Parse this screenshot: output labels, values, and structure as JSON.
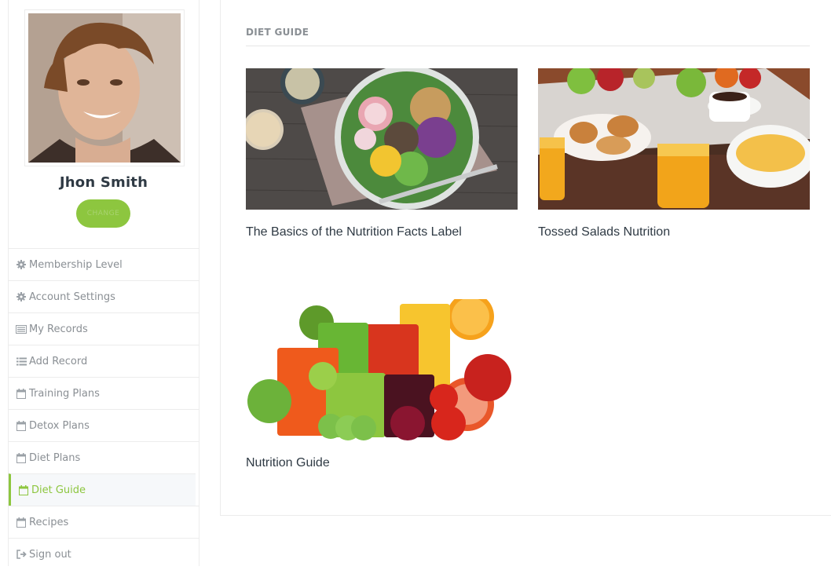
{
  "profile": {
    "name": "Jhon Smith",
    "change_label": "CHANGE"
  },
  "menu": [
    {
      "label": "Membership Level",
      "icon": "gear-icon"
    },
    {
      "label": "Account Settings",
      "icon": "gear-icon"
    },
    {
      "label": "My Records",
      "icon": "list-alt-icon"
    },
    {
      "label": "Add Record",
      "icon": "list-icon"
    },
    {
      "label": "Training Plans",
      "icon": "calendar-icon"
    },
    {
      "label": "Detox Plans",
      "icon": "calendar-icon"
    },
    {
      "label": "Diet Plans",
      "icon": "calendar-icon"
    },
    {
      "label": "Diet Guide",
      "icon": "calendar-icon",
      "active": true
    },
    {
      "label": "Recipes",
      "icon": "calendar-icon"
    },
    {
      "label": "Sign out",
      "icon": "sign-out-icon"
    }
  ],
  "main": {
    "title": "DIET GUIDE",
    "cards": [
      {
        "title": "The Basics of the Nutrition Facts Label",
        "image": "salad-bowl-photo"
      },
      {
        "title": "Tossed Salads Nutrition",
        "image": "breakfast-table-photo"
      },
      {
        "title": "Nutrition Guide",
        "image": "juices-photo"
      }
    ]
  },
  "colors": {
    "accent": "#8dc63f",
    "text": "#2f3a44",
    "muted": "#8a8f94"
  }
}
